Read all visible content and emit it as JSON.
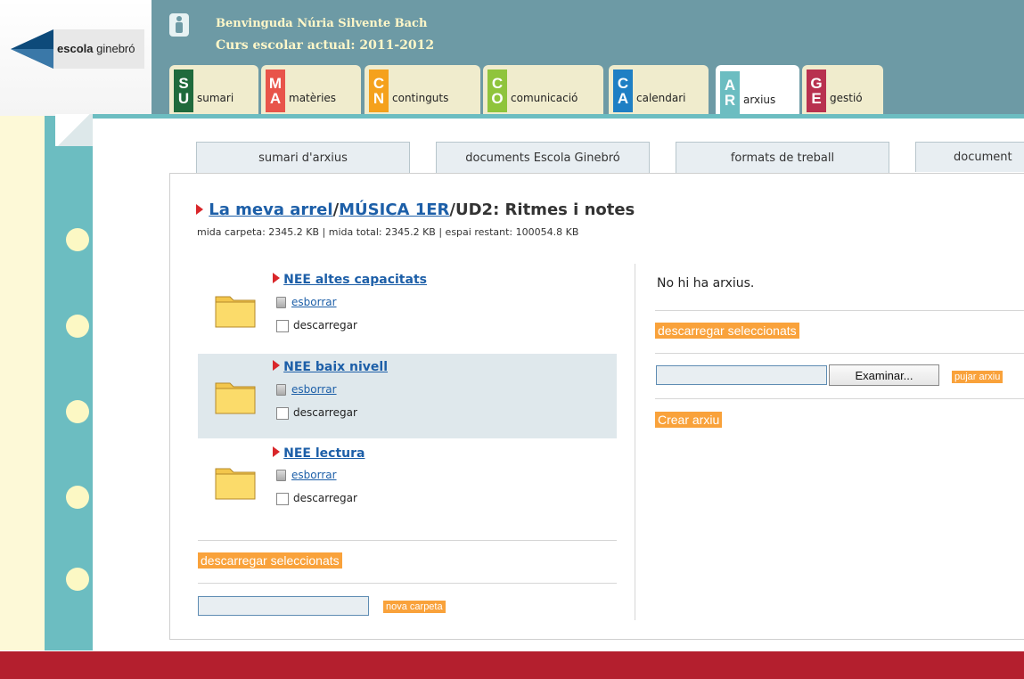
{
  "logo": {
    "brand": "escola",
    "brand_suffix": "ginebró"
  },
  "header": {
    "welcome": "Benvinguda Núria Silvente Bach",
    "course": "Curs escolar actual: 2011-2012"
  },
  "tabs": [
    {
      "code_top": "S",
      "code_bottom": "U",
      "label": "sumari",
      "color": "#1f6a3c",
      "active": false
    },
    {
      "code_top": "M",
      "code_bottom": "A",
      "label": "matèries",
      "color": "#e8544a",
      "active": false
    },
    {
      "code_top": "C",
      "code_bottom": "N",
      "label": "continguts",
      "color": "#f5a11c",
      "active": false
    },
    {
      "code_top": "C",
      "code_bottom": "O",
      "label": "comunicació",
      "color": "#8fc43c",
      "active": false
    },
    {
      "code_top": "C",
      "code_bottom": "A",
      "label": "calendari",
      "color": "#1f7fc4",
      "active": false
    },
    {
      "code_top": "A",
      "code_bottom": "R",
      "label": "arxius",
      "color": "#6cbdc1",
      "active": true
    },
    {
      "code_top": "G",
      "code_bottom": "E",
      "label": "gestió",
      "color": "#b8314f",
      "active": false
    }
  ],
  "subtabs": [
    "sumari d'arxius",
    "documents Escola Ginebró",
    "formats de treball",
    "document"
  ],
  "breadcrumb": {
    "root": "La meva arrel",
    "sep1": "/",
    "folder": "MÚSICA 1ER",
    "sep2": "/",
    "current": "UD2: Ritmes i notes"
  },
  "sizes": "mida carpeta: 2345.2 KB | mida total: 2345.2 KB | espai restant: 100054.8 KB",
  "folders": [
    {
      "name": "NEE  altes capacitats",
      "delete": "esborrar",
      "download": "descarregar"
    },
    {
      "name": "NEE  baix nivell",
      "delete": "esborrar",
      "download": "descarregar"
    },
    {
      "name": "NEE  lectura",
      "delete": "esborrar",
      "download": "descarregar"
    }
  ],
  "left_actions": {
    "download_selected": "descarregar seleccionats",
    "new_folder": "nova carpeta"
  },
  "right": {
    "no_files": "No hi ha arxius.",
    "download_selected": "descarregar seleccionats",
    "browse": "Examinar...",
    "upload": "pujar arxiu",
    "create": "Crear arxiu"
  },
  "colors": {
    "header": "#6d9aa5",
    "binder": "#6cbdc1",
    "footer": "#b41f2e",
    "accent_button": "#f9a23b",
    "link": "#1d5fa8"
  }
}
